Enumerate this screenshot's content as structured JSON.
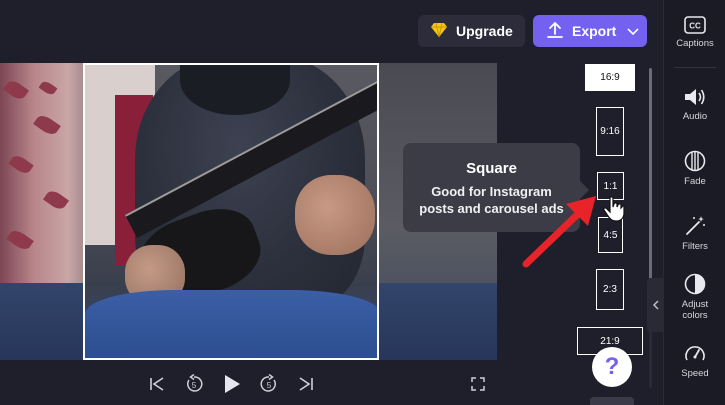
{
  "toolbar": {
    "upgrade_label": "Upgrade",
    "export_label": "Export",
    "upgrade_icon": "diamond-icon",
    "export_icon": "upload-icon"
  },
  "tooltip": {
    "title": "Square",
    "description_line1": "Good for Instagram",
    "description_line2": "posts and carousel ads"
  },
  "aspect_ratios": [
    {
      "label": "16:9",
      "selected": true
    },
    {
      "label": "9:16",
      "selected": false
    },
    {
      "label": "1:1",
      "selected": false
    },
    {
      "label": "4:5",
      "selected": false
    },
    {
      "label": "2:3",
      "selected": false
    },
    {
      "label": "21:9",
      "selected": false
    }
  ],
  "playback": {
    "skip_back_seconds": "5",
    "skip_forward_seconds": "5"
  },
  "help": {
    "label": "?"
  },
  "sidebar": {
    "items": [
      {
        "label": "Captions",
        "icon": "cc-icon"
      },
      {
        "label": "Audio",
        "icon": "speaker-icon"
      },
      {
        "label": "Fade",
        "icon": "fade-icon"
      },
      {
        "label": "Filters",
        "icon": "magic-wand-icon"
      },
      {
        "label_line1": "Adjust",
        "label_line2": "colors",
        "icon": "contrast-icon"
      },
      {
        "label": "Speed",
        "icon": "speedometer-icon"
      }
    ]
  },
  "colors": {
    "background": "#1f1f2b",
    "accent": "#7561f0",
    "arrow": "#e8232a"
  }
}
